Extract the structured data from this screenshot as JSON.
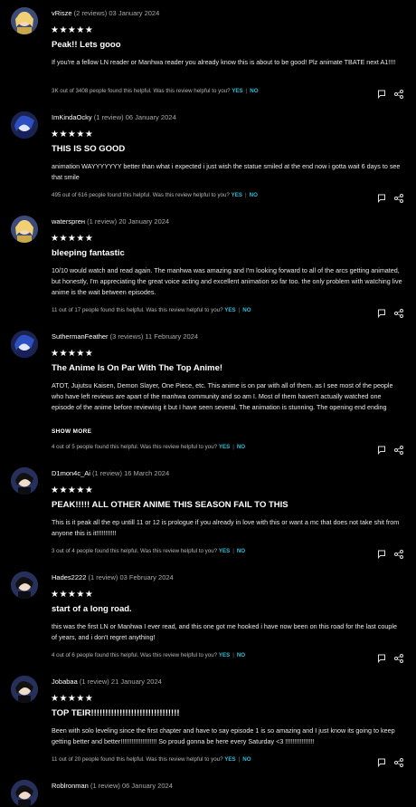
{
  "reviews": [
    {
      "user": "vRisze",
      "count": "(2 reviews)",
      "date": "03 January 2024",
      "stars": "★★★★★",
      "title": "Peak!! Lets gooo",
      "body": "If you're a fellow LN reader or Manhwa reader you already know this is about to be good! Plz animate TBATE next A1!!!!",
      "helpful": "3K out of 3408 people found this helpful. Was this review helpful to you?",
      "yes": "YES",
      "no": "NO",
      "avatar": "blonde"
    },
    {
      "user": "ImKindaOcky",
      "count": "(1 review)",
      "date": "06 January 2024",
      "stars": "★★★★★",
      "title": "THIS IS SO GOOD",
      "body": "animation WAYYYYYYY better than what i expected i just wish the statue smiled at the end now i gotta wait 6 days to see that smile",
      "helpful": "495 out of 616 people found this helpful. Was this review helpful to you?",
      "yes": "YES",
      "no": "NO",
      "avatar": "blue"
    },
    {
      "user": "watersprен",
      "count": "(1 review)",
      "date": "20 January 2024",
      "stars": "★★★★★",
      "title": "bleeping fantastic",
      "body": "10/10 would watch and read again. The manhwa was amazing and I'm looking forward to all of the arcs getting animated, but honestly, I'm appreciating the great voice acting and excellent animation so far too. the only problem with watching live anime is the wait between episodes.",
      "helpful": "11 out of 17 people found this helpful. Was this review helpful to you?",
      "yes": "YES",
      "no": "NO",
      "avatar": "blonde"
    },
    {
      "user": "SuthermanFeather",
      "count": "(3 reviews)",
      "date": "11 February 2024",
      "stars": "★★★★★",
      "title": "The Anime Is On Par With The Top Anime!",
      "body": "ATOT, Jujutsu Kaisen, Demon Slayer, One Piece, etc. This anime is on par with all of them. as I see most of the people who have left reviews are apart of the manhwa community and so am I. Most of them haven't actually watched one episode of the anime before reviewing it but I have seen several. The animation is stunning. The opening end ending songs are epic and done very well. they really get you hyped up for what's to come. The",
      "showmore": "SHOW MORE",
      "helpful": "4 out of 5 people found this helpful. Was this review helpful to you?",
      "yes": "YES",
      "no": "NO",
      "avatar": "blue"
    },
    {
      "user": "D1mon4c_Ai",
      "count": "(1 review)",
      "date": "16 March 2024",
      "stars": "★★★★★",
      "title": "PEAK!!!!! ALL OTHER ANIME THIS SEASON FAIL TO THIS",
      "body": "This is it peak all the ep untill 11 or 12 is prologue if you already in love with this or want a mc that does not take shit from anyone this is it!!!!!!!!!!!",
      "helpful": "3 out of 4 people found this helpful. Was this review helpful to you?",
      "yes": "YES",
      "no": "NO",
      "avatar": "dark"
    },
    {
      "user": "Hades2222",
      "count": "(1 review)",
      "date": "03 February 2024",
      "stars": "★★★★★",
      "title": "start of a long road.",
      "body": "this was the first LN or Manhwa I ever read, and this one got me hooked i have now been on this road for the last couple of years, and i don't regret anything!",
      "helpful": "4 out of 6 people found this helpful. Was this review helpful to you?",
      "yes": "YES",
      "no": "NO",
      "avatar": "dark"
    },
    {
      "user": "Jobabaa",
      "count": "(1 review)",
      "date": "21 January 2024",
      "stars": "★★★★★",
      "title": "TOP TEIR!!!!!!!!!!!!!!!!!!!!!!!!!!!!!!!",
      "body": "Been with solo leveling since the first chapter and have to say episode 1 is so amazing and I just know its going to keep getting better and better!!!!!!!!!!!!!!!!!!!! So proud gonna be here every Saturday <3 !!!!!!!!!!!!!!!!",
      "helpful": "11 out of 20 people found this helpful. Was this review helpful to you?",
      "yes": "YES",
      "no": "NO",
      "avatar": "dark"
    },
    {
      "user": "Roblronman",
      "count": "(1 review)",
      "date": "06 January 2024",
      "avatar": "dark"
    }
  ],
  "icon_names": [
    "flag-icon",
    "share-icon"
  ]
}
